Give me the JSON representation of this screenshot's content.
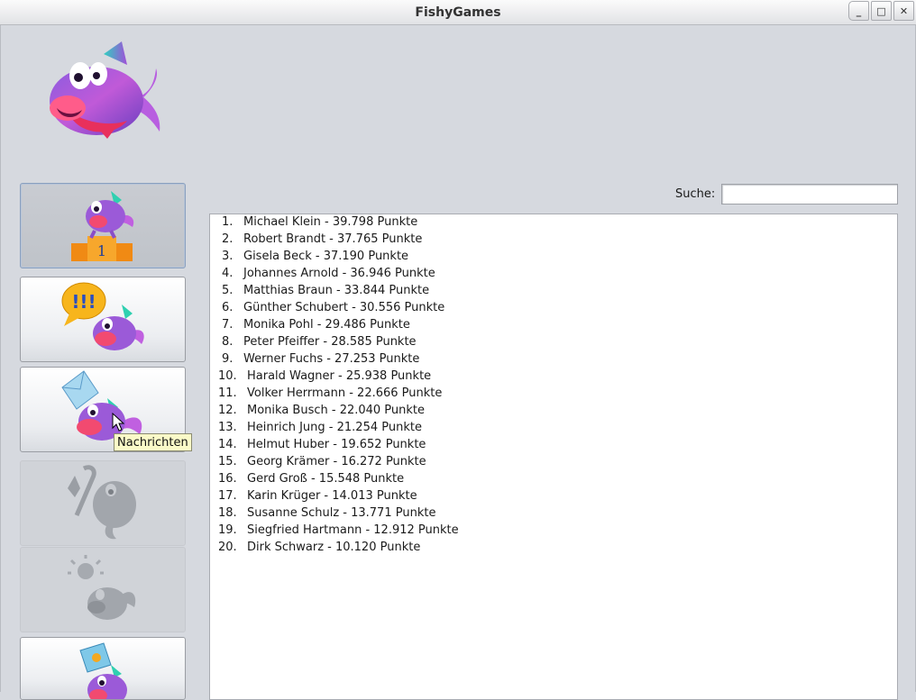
{
  "window": {
    "title": "FishyGames",
    "controls": [
      "minimize",
      "maximize",
      "close"
    ]
  },
  "sidebar": {
    "items": [
      {
        "name": "ranking",
        "icon": "podium-fish-icon",
        "state": "selected"
      },
      {
        "name": "chat",
        "icon": "speech-bubble-fish-icon",
        "state": "normal"
      },
      {
        "name": "messages",
        "icon": "envelope-fish-icon",
        "state": "hover"
      },
      {
        "name": "tools",
        "icon": "wrench-fish-icon",
        "state": "disabled"
      },
      {
        "name": "ideas",
        "icon": "lightbulb-fish-icon",
        "state": "disabled"
      },
      {
        "name": "pictures",
        "icon": "picture-fish-icon",
        "state": "normal"
      }
    ],
    "tooltip": "Nachrichten"
  },
  "search": {
    "label": "Suche:",
    "value": ""
  },
  "ranking": [
    {
      "num": "1.",
      "text": "Michael Klein - 39.798 Punkte"
    },
    {
      "num": "2.",
      "text": "Robert Brandt - 37.765 Punkte"
    },
    {
      "num": "3.",
      "text": "Gisela Beck - 37.190 Punkte"
    },
    {
      "num": "4.",
      "text": "Johannes Arnold - 36.946 Punkte"
    },
    {
      "num": "5.",
      "text": "Matthias Braun - 33.844 Punkte"
    },
    {
      "num": "6.",
      "text": "Günther Schubert - 30.556 Punkte"
    },
    {
      "num": "7.",
      "text": "Monika Pohl - 29.486 Punkte"
    },
    {
      "num": "8.",
      "text": "Peter Pfeiffer - 28.585 Punkte"
    },
    {
      "num": "9.",
      "text": "Werner Fuchs - 27.253 Punkte"
    },
    {
      "num": "10.",
      "text": "Harald Wagner - 25.938 Punkte"
    },
    {
      "num": "11.",
      "text": "Volker Herrmann - 22.666 Punkte"
    },
    {
      "num": "12.",
      "text": "Monika Busch - 22.040 Punkte"
    },
    {
      "num": "13.",
      "text": "Heinrich Jung - 21.254 Punkte"
    },
    {
      "num": "14.",
      "text": "Helmut Huber - 19.652 Punkte"
    },
    {
      "num": "15.",
      "text": "Georg Krämer - 16.272 Punkte"
    },
    {
      "num": "16.",
      "text": "Gerd Groß - 15.548 Punkte"
    },
    {
      "num": "17.",
      "text": "Karin Krüger - 14.013 Punkte"
    },
    {
      "num": "18.",
      "text": "Susanne Schulz - 13.771 Punkte"
    },
    {
      "num": "19.",
      "text": "Siegfried Hartmann - 12.912 Punkte"
    },
    {
      "num": "20.",
      "text": "Dirk Schwarz - 10.120 Punkte"
    }
  ],
  "colors": {
    "background": "#d6d9df",
    "fish_purple": "#a24fd6",
    "fish_pink": "#e0306e",
    "podium_orange": "#f39a1c",
    "tooltip_bg": "#fafac8"
  }
}
